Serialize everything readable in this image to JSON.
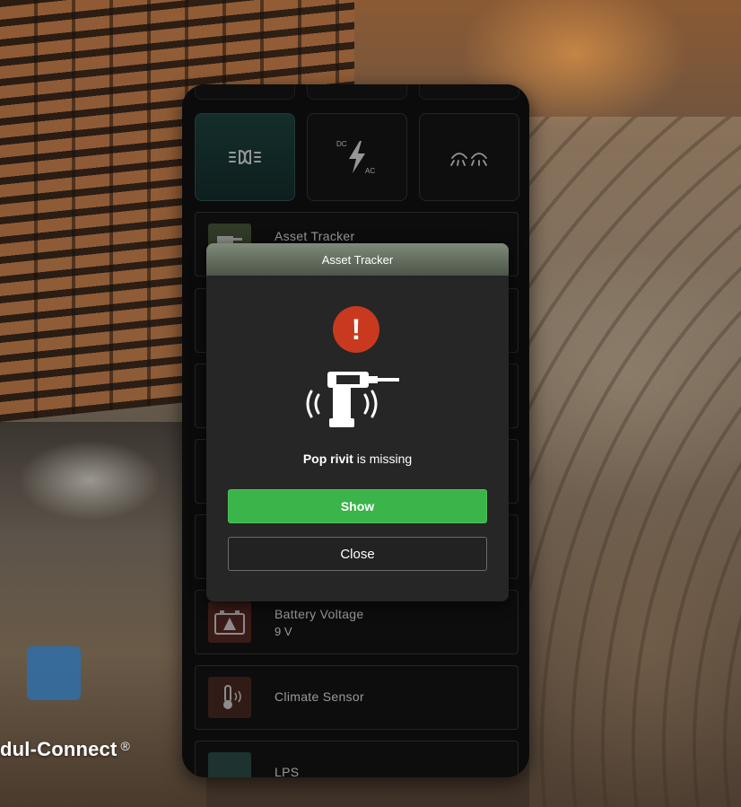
{
  "brand": {
    "name": "dul-Connect",
    "mark": "®"
  },
  "tiles": [
    {
      "icon": "lights-icon",
      "active": true
    },
    {
      "icon": "dc-ac-charger-icon",
      "dc_label": "DC",
      "ac_label": "AC",
      "active": false
    },
    {
      "icon": "interior-lights-icon",
      "active": false
    }
  ],
  "list": {
    "asset_tracker": {
      "title": "Asset Tracker"
    },
    "battery_voltage": {
      "title": "Battery Voltage",
      "value": "9 V"
    },
    "climate_sensor": {
      "title": "Climate Sensor"
    },
    "lps": {
      "title": "LPS"
    }
  },
  "modal": {
    "title": "Asset Tracker",
    "alert_glyph": "!",
    "item_name": "Pop rivit",
    "message_suffix": " is missing",
    "show_label": "Show",
    "close_label": "Close"
  },
  "colors": {
    "alert": "#c8391f",
    "show_button": "#3bb44a",
    "active_tile": "#1f4744"
  }
}
